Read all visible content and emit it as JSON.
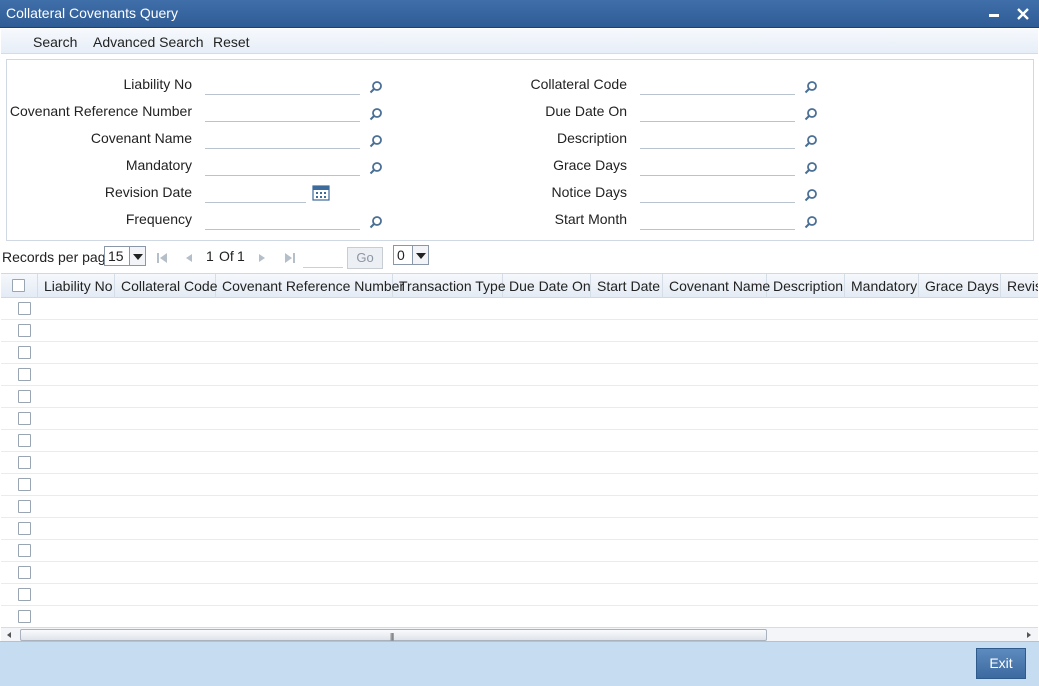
{
  "window": {
    "title": "Collateral Covenants Query",
    "minimize_glyph": "▬",
    "close_glyph": "✕"
  },
  "toolbar": {
    "search": "Search",
    "advanced_search": "Advanced Search",
    "reset": "Reset"
  },
  "criteria": {
    "left": [
      {
        "label": "Liability No",
        "value": "",
        "icon": "search-icon"
      },
      {
        "label": "Covenant Reference Number",
        "value": "",
        "icon": "search-icon"
      },
      {
        "label": "Covenant Name",
        "value": "",
        "icon": "search-icon"
      },
      {
        "label": "Mandatory",
        "value": "",
        "icon": "search-icon"
      },
      {
        "label": "Revision Date",
        "value": "",
        "icon": "calendar-icon"
      },
      {
        "label": "Frequency",
        "value": "",
        "icon": "search-icon"
      }
    ],
    "right": [
      {
        "label": "Collateral Code",
        "value": "",
        "icon": "search-icon"
      },
      {
        "label": "Due Date On",
        "value": "",
        "icon": "search-icon"
      },
      {
        "label": "Description",
        "value": "",
        "icon": "search-icon"
      },
      {
        "label": "Grace Days",
        "value": "",
        "icon": "search-icon"
      },
      {
        "label": "Notice Days",
        "value": "",
        "icon": "search-icon"
      },
      {
        "label": "Start Month",
        "value": "",
        "icon": "search-icon"
      }
    ]
  },
  "pager": {
    "records_per_page_label": "Records per page",
    "records_per_page_value": "15",
    "current_page": "1",
    "of_label": "Of",
    "total_pages": "1",
    "go_label": "Go",
    "goto_value": "",
    "selection_count": "0"
  },
  "grid": {
    "columns": [
      "Liability No",
      "Collateral Code",
      "Covenant Reference Number",
      "Transaction Type",
      "Due Date On",
      "Start Date",
      "Covenant Name",
      "Description",
      "Mandatory",
      "Grace Days",
      "Revisi"
    ],
    "empty_rows": 15
  },
  "footer": {
    "exit_label": "Exit"
  },
  "colors": {
    "title_bar": "#2f5c95",
    "footer_bg": "#c6dcf0",
    "exit_button": "#3c6aa0",
    "lov_icon": "#4a6f95"
  }
}
